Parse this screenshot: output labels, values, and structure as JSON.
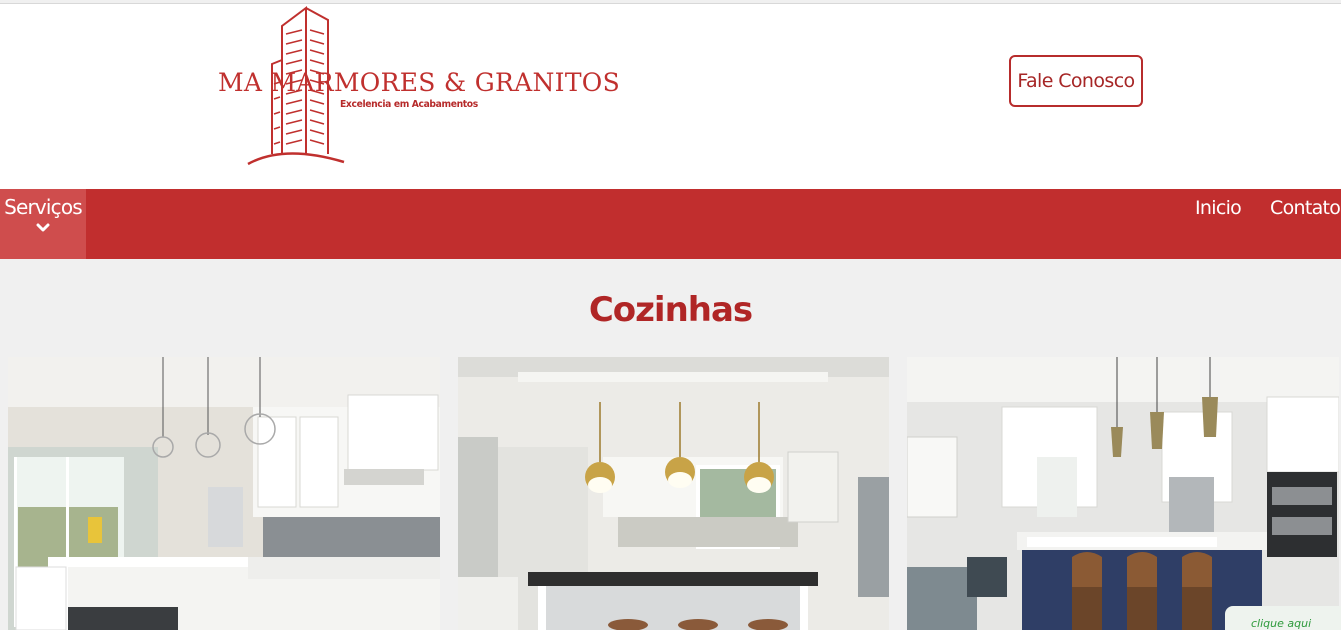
{
  "header": {
    "brand_name": "MA MARMORES & GRANITOS",
    "tagline": "Excelencia em Acabamentos",
    "cta_label": "Fale Conosco"
  },
  "nav": {
    "dropdown_label": "Serviços",
    "dropdown_icon": "chevron-down-icon",
    "links": [
      {
        "label": "Inicio"
      },
      {
        "label": "Contato"
      }
    ]
  },
  "main": {
    "section_title": "Cozinhas",
    "gallery": [
      {
        "subject": "white-kitchen-with-window-and-pendant-lights"
      },
      {
        "subject": "kitchen-with-brass-pendant-lights-and-island"
      },
      {
        "subject": "kitchen-with-island-and-leather-stools"
      }
    ]
  },
  "chat_widget": {
    "text": "clique aqui"
  },
  "colors": {
    "brand_red": "#c12e2e",
    "dropdown_bg": "#cf4d4d",
    "title_red": "#b02626",
    "page_bg": "#f0f0f0"
  }
}
